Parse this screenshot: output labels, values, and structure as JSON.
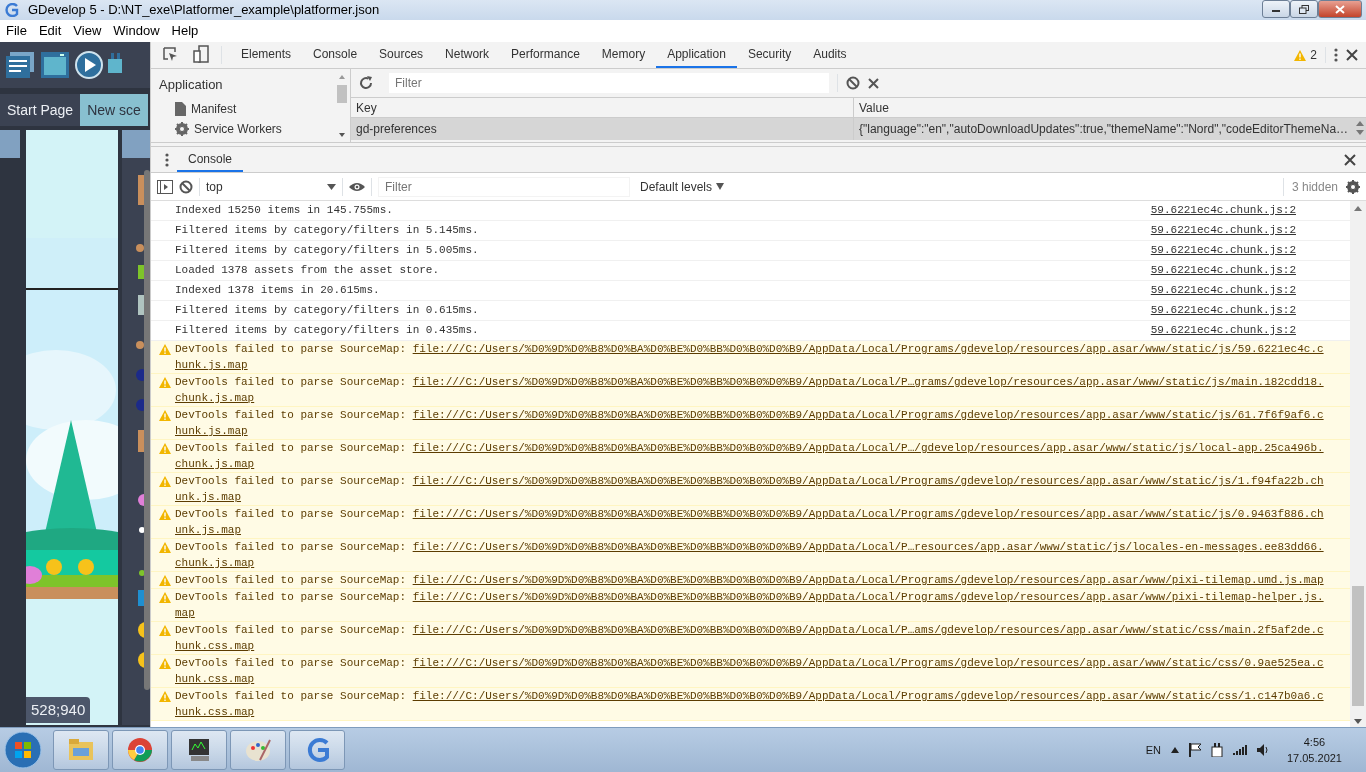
{
  "window": {
    "title": "GDevelop 5 - D:\\NT_exe\\Platformer_example\\platformer.json"
  },
  "menu": [
    "File",
    "Edit",
    "View",
    "Window",
    "Help"
  ],
  "editor": {
    "tabs": [
      {
        "label": "Start Page",
        "selected": false
      },
      {
        "label": "New sce",
        "selected": true
      }
    ],
    "coordinates": "528;940"
  },
  "devtools": {
    "tabs": [
      {
        "label": "Elements",
        "selected": false
      },
      {
        "label": "Console",
        "selected": false
      },
      {
        "label": "Sources",
        "selected": false
      },
      {
        "label": "Network",
        "selected": false
      },
      {
        "label": "Performance",
        "selected": false
      },
      {
        "label": "Memory",
        "selected": false
      },
      {
        "label": "Application",
        "selected": true
      },
      {
        "label": "Security",
        "selected": false
      },
      {
        "label": "Audits",
        "selected": false
      }
    ],
    "warnings_count": "2",
    "application": {
      "sidebar_title": "Application",
      "sidebar_items": [
        "Manifest",
        "Service Workers"
      ],
      "filter_placeholder": "Filter",
      "columns": [
        "Key",
        "Value"
      ],
      "rows": [
        {
          "key": "gd-preferences",
          "value": "{\"language\":\"en\",\"autoDownloadUpdates\":true,\"themeName\":\"Nord\",\"codeEditorThemeNa…",
          "selected": true
        }
      ]
    },
    "drawer_tab": "Console",
    "console": {
      "context": "top",
      "filter_placeholder": "Filter",
      "levels": "Default levels",
      "hidden": "3 hidden",
      "messages": [
        {
          "kind": "log",
          "text": "Indexed 15250 items in 145.755ms.",
          "source": "59.6221ec4c.chunk.js:2"
        },
        {
          "kind": "log",
          "text": "Filtered items by category/filters in 5.145ms.",
          "source": "59.6221ec4c.chunk.js:2"
        },
        {
          "kind": "log",
          "text": "Filtered items by category/filters in 5.005ms.",
          "source": "59.6221ec4c.chunk.js:2"
        },
        {
          "kind": "log",
          "text": "Loaded 1378 assets from the asset store.",
          "source": "59.6221ec4c.chunk.js:2"
        },
        {
          "kind": "log",
          "text": "Indexed 1378 items in 20.615ms.",
          "source": "59.6221ec4c.chunk.js:2"
        },
        {
          "kind": "log",
          "text": "Filtered items by category/filters in 0.615ms.",
          "source": "59.6221ec4c.chunk.js:2"
        },
        {
          "kind": "log",
          "text": "Filtered items by category/filters in 0.435ms.",
          "source": "59.6221ec4c.chunk.js:2"
        },
        {
          "kind": "warning",
          "text": "DevTools failed to parse SourceMap: ",
          "link": "file:///C:/Users/%D0%9D%D0%B8%D0%BA%D0%BE%D0%BB%D0%B0%D0%B9/AppData/Local/Programs/gdevelop/resources/app.asar/www/static/js/59.6221ec4c.chunk.js.map"
        },
        {
          "kind": "warning",
          "text": "DevTools failed to parse SourceMap: ",
          "link": "file:///C:/Users/%D0%9D%D0%B8%D0%BA%D0%BE%D0%BB%D0%B0%D0%B9/AppData/Local/P…grams/gdevelop/resources/app.asar/www/static/js/main.182cdd18.chunk.js.map"
        },
        {
          "kind": "warning",
          "text": "DevTools failed to parse SourceMap: ",
          "link": "file:///C:/Users/%D0%9D%D0%B8%D0%BA%D0%BE%D0%BB%D0%B0%D0%B9/AppData/Local/Programs/gdevelop/resources/app.asar/www/static/js/61.7f6f9af6.chunk.js.map"
        },
        {
          "kind": "warning",
          "text": "DevTools failed to parse SourceMap: ",
          "link": "file:///C:/Users/%D0%9D%D0%B8%D0%BA%D0%BE%D0%BB%D0%B0%D0%B9/AppData/Local/P…/gdevelop/resources/app.asar/www/static/js/local-app.25ca496b.chunk.js.map"
        },
        {
          "kind": "warning",
          "text": "DevTools failed to parse SourceMap: ",
          "link": "file:///C:/Users/%D0%9D%D0%B8%D0%BA%D0%BE%D0%BB%D0%B0%D0%B9/AppData/Local/Programs/gdevelop/resources/app.asar/www/static/js/1.f94fa22b.chunk.js.map"
        },
        {
          "kind": "warning",
          "text": "DevTools failed to parse SourceMap: ",
          "link": "file:///C:/Users/%D0%9D%D0%B8%D0%BA%D0%BE%D0%BB%D0%B0%D0%B9/AppData/Local/Programs/gdevelop/resources/app.asar/www/static/js/0.9463f886.chunk.js.map"
        },
        {
          "kind": "warning",
          "text": "DevTools failed to parse SourceMap: ",
          "link": "file:///C:/Users/%D0%9D%D0%B8%D0%BA%D0%BE%D0%BB%D0%B0%D0%B9/AppData/Local/P…resources/app.asar/www/static/js/locales-en-messages.ee83dd66.chunk.js.map"
        },
        {
          "kind": "warning",
          "text": "DevTools failed to parse SourceMap: ",
          "link": "file:///C:/Users/%D0%9D%D0%B8%D0%BA%D0%BE%D0%BB%D0%B0%D0%B9/AppData/Local/Programs/gdevelop/resources/app.asar/www/pixi-tilemap.umd.js.map"
        },
        {
          "kind": "warning",
          "text": "DevTools failed to parse SourceMap: ",
          "link": "file:///C:/Users/%D0%9D%D0%B8%D0%BA%D0%BE%D0%BB%D0%B0%D0%B9/AppData/Local/Programs/gdevelop/resources/app.asar/www/pixi-tilemap-helper.js.map"
        },
        {
          "kind": "warning",
          "text": "DevTools failed to parse SourceMap: ",
          "link": "file:///C:/Users/%D0%9D%D0%B8%D0%BA%D0%BE%D0%BB%D0%B0%D0%B9/AppData/Local/P…ams/gdevelop/resources/app.asar/www/static/css/main.2f5af2de.chunk.css.map"
        },
        {
          "kind": "warning",
          "text": "DevTools failed to parse SourceMap: ",
          "link": "file:///C:/Users/%D0%9D%D0%B8%D0%BA%D0%BE%D0%BB%D0%B0%D0%B9/AppData/Local/Programs/gdevelop/resources/app.asar/www/static/css/0.9ae525ea.chunk.css.map"
        },
        {
          "kind": "warning",
          "text": "DevTools failed to parse SourceMap: ",
          "link": "file:///C:/Users/%D0%9D%D0%B8%D0%BA%D0%BE%D0%BB%D0%B0%D0%B9/AppData/Local/Programs/gdevelop/resources/app.asar/www/static/css/1.c147b0a6.chunk.css.map"
        }
      ]
    }
  },
  "taskbar": {
    "language": "EN",
    "time": "4:56",
    "date": "17.05.2021"
  }
}
